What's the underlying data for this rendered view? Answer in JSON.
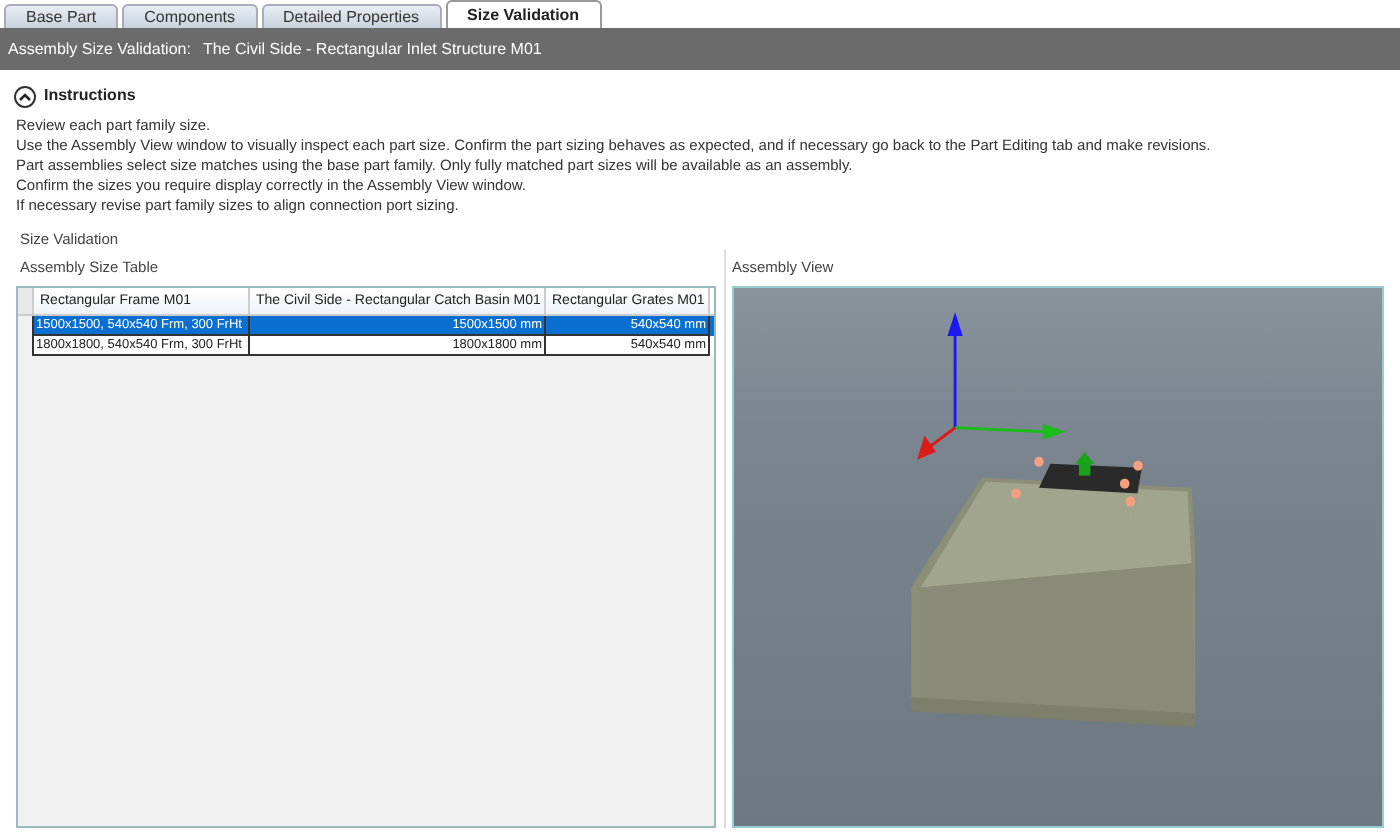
{
  "tabs": [
    {
      "label": "Base Part",
      "selected": false
    },
    {
      "label": "Components",
      "selected": false
    },
    {
      "label": "Detailed Properties",
      "selected": false
    },
    {
      "label": "Size Validation",
      "selected": true
    }
  ],
  "header": {
    "label": "Assembly Size Validation:",
    "value": "The Civil Side - Rectangular Inlet Structure M01"
  },
  "instructions": {
    "title": "Instructions",
    "expanded": true,
    "lines": [
      "Review each part family size.",
      "Use the Assembly View window to visually inspect each part size. Confirm the part sizing behaves as expected, and if necessary go back to the Part Editing tab and make revisions.",
      "Part assemblies select size matches using the base part family. Only fully matched part sizes will be available as an assembly.",
      "Confirm the sizes you require display correctly in the Assembly View window.",
      "If necessary revise part family sizes to align connection port sizing."
    ]
  },
  "size_validation": {
    "title": "Size Validation",
    "table": {
      "title": "Assembly Size Table",
      "columns": [
        "Rectangular Frame M01",
        "The Civil Side - Rectangular Catch Basin M01",
        "Rectangular Grates M01"
      ],
      "rows": [
        {
          "cells": [
            "1500x1500, 540x540 Frm, 300 FrHt",
            "1500x1500 mm",
            "540x540 mm"
          ],
          "selected": true
        },
        {
          "cells": [
            "1800x1800, 540x540 Frm, 300 FrHt",
            "1800x1800 mm",
            "540x540 mm"
          ],
          "selected": false
        }
      ]
    },
    "view": {
      "title": "Assembly View"
    }
  }
}
